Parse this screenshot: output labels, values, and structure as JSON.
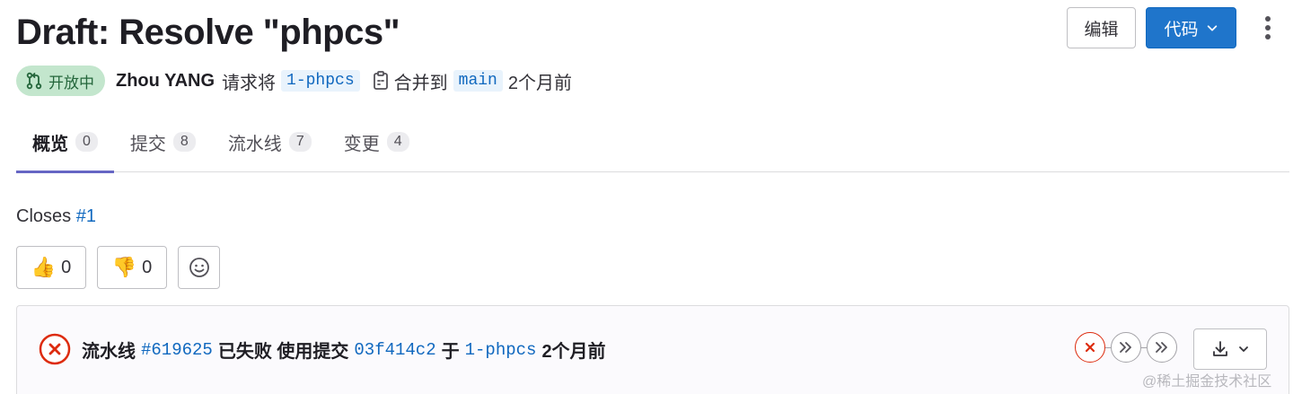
{
  "header": {
    "title": "Draft: Resolve \"phpcs\"",
    "edit_label": "编辑",
    "code_label": "代码"
  },
  "meta": {
    "status_label": "开放中",
    "author": "Zhou YANG",
    "request_text": "请求将",
    "source_branch": "1-phpcs",
    "merge_text": "合并到",
    "target_branch": "main",
    "time": "2个月前"
  },
  "tabs": [
    {
      "label": "概览",
      "count": "0"
    },
    {
      "label": "提交",
      "count": "8"
    },
    {
      "label": "流水线",
      "count": "7"
    },
    {
      "label": "变更",
      "count": "4"
    }
  ],
  "description": {
    "closes_label": "Closes",
    "issue_ref": "#1"
  },
  "awards": {
    "thumbs_up": "0",
    "thumbs_down": "0",
    "thumbs_up_emoji": "👍",
    "thumbs_down_emoji": "👎"
  },
  "pipeline": {
    "label": "流水线",
    "id": "#619625",
    "status_text": "已失败 使用提交",
    "commit": "03f414c2",
    "on_text": "于",
    "branch": "1-phpcs",
    "time": "2个月前"
  },
  "watermark": "@稀土掘金技术社区",
  "colors": {
    "accent": "#1f75cb",
    "link": "#1068bf",
    "open_badge_bg": "#c3e6cd",
    "failed": "#dd2b0e",
    "active_tab": "#6666c4"
  }
}
